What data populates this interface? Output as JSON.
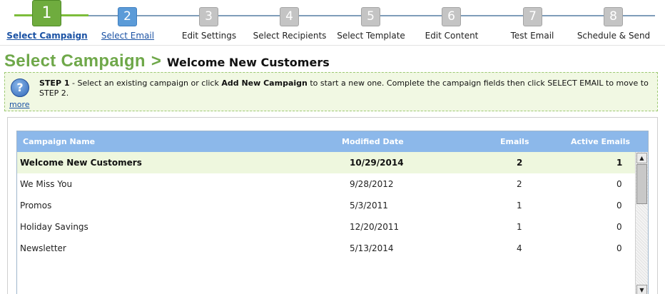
{
  "wizard": {
    "steps": [
      {
        "number": "1",
        "label": "Select Campaign"
      },
      {
        "number": "2",
        "label": "Select Email"
      },
      {
        "number": "3",
        "label": "Edit Settings"
      },
      {
        "number": "4",
        "label": "Select Recipients"
      },
      {
        "number": "5",
        "label": "Select Template"
      },
      {
        "number": "6",
        "label": "Edit Content"
      },
      {
        "number": "7",
        "label": "Test Email"
      },
      {
        "number": "8",
        "label": "Schedule & Send"
      }
    ]
  },
  "header": {
    "title": "Select Campaign",
    "separator": ">",
    "campaign_name": "Welcome New Customers"
  },
  "help": {
    "step": "STEP 1",
    "text_1": " - Select an existing campaign or click ",
    "add_new": "Add New Campaign",
    "text_2": " to start a new one.  Complete the campaign fields then click SELECT EMAIL to move to STEP 2.",
    "more": "more"
  },
  "grid": {
    "columns": [
      "Campaign Name",
      "Modified Date",
      "Emails",
      "Active Emails"
    ],
    "rows": [
      {
        "name": "Welcome New Customers",
        "modified": "10/29/2014",
        "emails": "2",
        "active": "1"
      },
      {
        "name": "We Miss You",
        "modified": "9/28/2012",
        "emails": "2",
        "active": "0"
      },
      {
        "name": "Promos",
        "modified": "5/3/2011",
        "emails": "1",
        "active": "0"
      },
      {
        "name": "Holiday Savings",
        "modified": "12/20/2011",
        "emails": "1",
        "active": "0"
      },
      {
        "name": "Newsletter",
        "modified": "5/13/2014",
        "emails": "4",
        "active": "0"
      }
    ],
    "selected_row": 0,
    "scroll_up": "▲",
    "scroll_down": "▼"
  }
}
